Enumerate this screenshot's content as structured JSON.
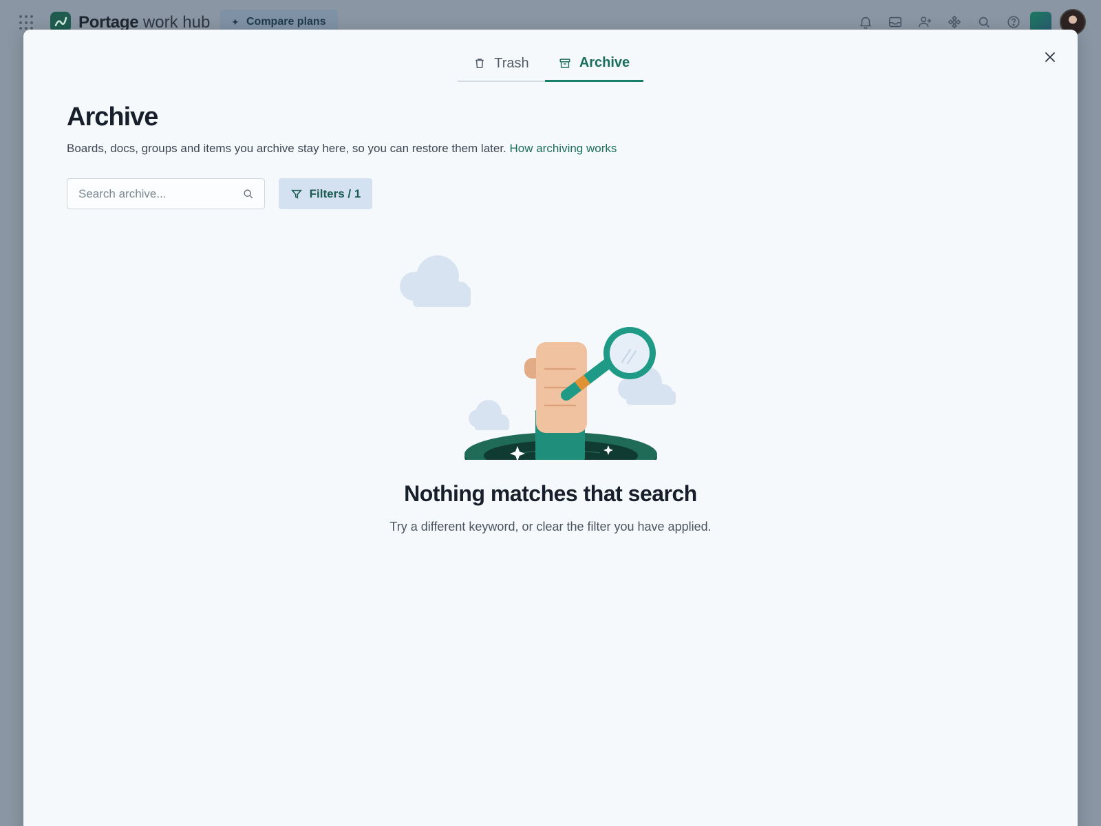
{
  "app": {
    "brand_bold": "Portage",
    "brand_rest": " work hub",
    "compare_label": "Compare plans"
  },
  "top_icons": [
    "bell-icon",
    "inbox-icon",
    "invite-member-icon",
    "apps-puzzle-icon",
    "search-icon",
    "help-icon"
  ],
  "modal": {
    "tabs": [
      {
        "label": "Trash",
        "icon": "trash-icon",
        "selected": false
      },
      {
        "label": "Archive",
        "icon": "archive-box-icon",
        "selected": true
      }
    ],
    "title": "Archive",
    "subtitle": "Boards, docs, groups and items you archive stay here, so you can restore them later. ",
    "subtitle_link": "How archiving works",
    "search": {
      "placeholder": "Search archive...",
      "value": ""
    },
    "filters_label": "Filters / 1",
    "empty_title": "Nothing matches that search",
    "empty_subtitle": "Try a different keyword, or clear the filter you have applied."
  },
  "colors": {
    "accent": "#1a7d67",
    "modal_bg": "#f6f9fc",
    "filters_bg": "#d3e1f0",
    "backdrop": "#8a96a3"
  }
}
